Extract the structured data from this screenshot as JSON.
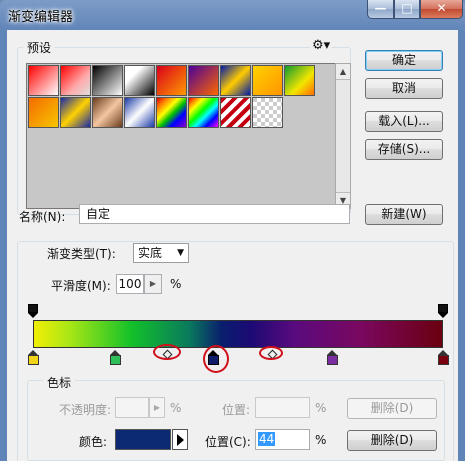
{
  "window": {
    "title": "渐变编辑器"
  },
  "window_buttons": {
    "minimize": "—",
    "maximize": "□",
    "close": "✕"
  },
  "presets": {
    "label": "预设",
    "gear_icon": "gear-icon",
    "swatches": [
      {
        "bg": "linear-gradient(135deg,#ff0000,#ffffff)"
      },
      {
        "bg": "linear-gradient(135deg,#ff0000,#ffaaaa 60%,#dddddd)"
      },
      {
        "bg": "linear-gradient(135deg,#000000,#ffffff)"
      },
      {
        "bg": "linear-gradient(135deg,#ffffff,#ffffff 30%,#000000)"
      },
      {
        "bg": "linear-gradient(135deg,#d9001b,#ff9a00)"
      },
      {
        "bg": "linear-gradient(135deg,#4b0099,#ff6600)"
      },
      {
        "bg": "linear-gradient(135deg,#001aa8,#ffcc00 50%,#001aa8)"
      },
      {
        "bg": "linear-gradient(135deg,#ffd200,#ff9500)"
      },
      {
        "bg": "linear-gradient(135deg,#0f9a2f,#f2e600 60%,#ff6a00)"
      },
      {
        "bg": "linear-gradient(135deg,#f46b00,#f7c600)"
      },
      {
        "bg": "linear-gradient(135deg,#1a2aa8,#ffd200 50%,#1a2aa8)"
      },
      {
        "bg": "linear-gradient(135deg,#6b3d1e,#f3c5a0 50%,#6b3d1e)"
      },
      {
        "bg": "linear-gradient(135deg,#1b3aa8,#ffffff 50%,#1b3aa8)"
      },
      {
        "bg": "linear-gradient(135deg,#e00000,#ff8a00 20%,#ffff00 38%,#00c000 55%,#0000ff 73%,#8a00c8)"
      },
      {
        "bg": "linear-gradient(135deg,#ff0000,#ffff00 25%,#00ff00 45%,#00ffff 60%,#0000ff 78%,#ff00ff)"
      },
      {
        "bg": "repeating-linear-gradient(135deg,#c40010 0,#c40010 4px,#ffffff 4px,#ffffff 8px)"
      },
      {
        "bg": "repeating-conic-gradient(#ffffff 0% 25%, #cccccc 0% 50%) 0 0/8px 8px"
      }
    ]
  },
  "buttons": {
    "ok": "确定",
    "cancel": "取消",
    "load": "载入(L)...",
    "save": "存储(S)...",
    "new": "新建(W)",
    "delete_opacity": "删除(D)",
    "delete_color": "删除(D)"
  },
  "name": {
    "label": "名称(N):",
    "value": "自定"
  },
  "gradient": {
    "type_label": "渐变类型(T):",
    "type_value": "实底",
    "smoothness_label": "平滑度(M):",
    "smoothness_value": "100",
    "smoothness_unit": "%"
  },
  "color_stops": [
    {
      "color": "#f2d31a",
      "position_pct": 0
    },
    {
      "color": "#2fbf59",
      "position_pct": 20
    },
    {
      "color": "#0f1e6a",
      "position_pct": 44,
      "selected": true
    },
    {
      "color": "#7a2ea0",
      "position_pct": 73
    },
    {
      "color": "#7a0010",
      "position_pct": 100
    }
  ],
  "opacity_stops": [
    {
      "position_pct": 0
    },
    {
      "position_pct": 100
    }
  ],
  "stops": {
    "label": "色标",
    "opacity_label": "不透明度:",
    "opacity_unit": "%",
    "opacity_position_label": "位置:",
    "opacity_position_unit": "%",
    "color_label": "颜色:",
    "color_value": "#0c2a73",
    "color_position_label": "位置(C):",
    "color_position_value": "44",
    "color_position_unit": "%"
  }
}
